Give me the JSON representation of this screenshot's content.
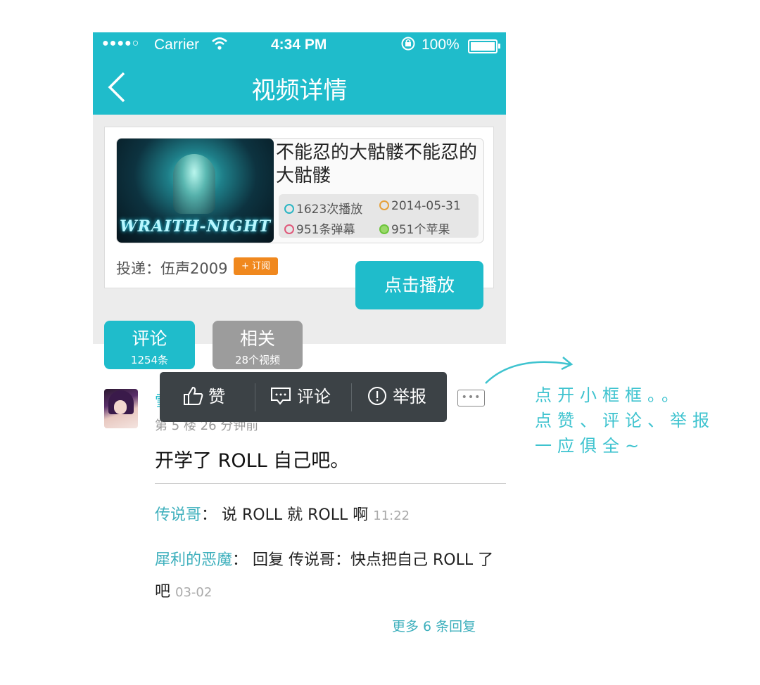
{
  "status_bar": {
    "signal": "●●●●○",
    "carrier": "Carrier",
    "time": "4:34 PM",
    "battery": "100%"
  },
  "nav": {
    "title": "视频详情"
  },
  "video": {
    "thumb_text": "WRAITH-NIGHT",
    "title": "不能忍的大骷髅不能忍的大骷髅",
    "plays": "1623次播放",
    "date": "2014-05-31",
    "danmaku": "951条弹幕",
    "apples": "951个苹果",
    "sender": "投递：伍声2009",
    "subscribe": "+ 订阅",
    "play_button": "点击播放"
  },
  "tabs": [
    {
      "label": "评论",
      "sub": "1254条"
    },
    {
      "label": "相关",
      "sub": "28个视频"
    }
  ],
  "popup_menu": {
    "like": "赞",
    "comment": "评论",
    "report": "举报"
  },
  "comment": {
    "username_partial": "雪",
    "meta": "第 5 楼  26 分钟前",
    "text": "开学了 ROLL 自己吧。",
    "replies": [
      {
        "name": "传说哥",
        "sep": "：",
        "text": "说 ROLL 就 ROLL 啊",
        "time": "11:22"
      },
      {
        "name": "犀利的恶魔",
        "sep": "：",
        "text": "回复 传说哥：快点把自己 ROLL 了吧",
        "time": "03-02"
      }
    ],
    "more": "更多 6 条回复"
  },
  "annotation": {
    "line1": "点开小框框。。",
    "line2": "点赞、评论、举报",
    "line3": "一应俱全~"
  },
  "colors": {
    "accent": "#1fbccb",
    "orange": "#f0881e",
    "popup": "#3c4246",
    "annotation": "#3ec3cf"
  },
  "icons": [
    "back-icon",
    "wifi-icon",
    "lock-icon",
    "battery-icon",
    "play-count-icon",
    "clock-icon",
    "danmaku-icon",
    "apple-icon",
    "thumbs-up-icon",
    "comment-icon",
    "report-icon",
    "more-dots-icon"
  ]
}
